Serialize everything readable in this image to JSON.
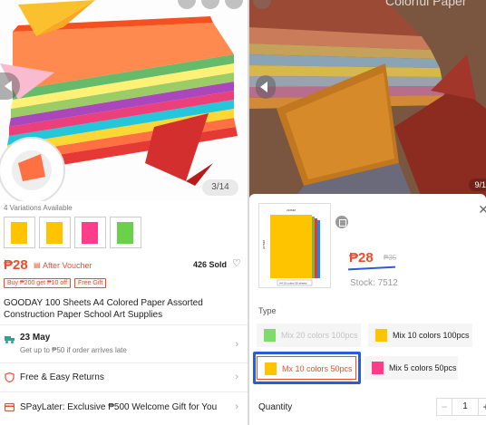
{
  "left": {
    "image_counter": "3/14",
    "variations_label": "4 Variations Available",
    "thumbnail_colors": [
      "#ffc400",
      "#ffc400",
      "#ff3d8b",
      "#6bd04a"
    ],
    "price": "₱28",
    "price_icon": "voucher-tag-icon",
    "after_voucher": "After Voucher",
    "sold": "426 Sold",
    "vouchers": [
      "Buy ₱200 get ₱10 off",
      "Free Gift"
    ],
    "title": "GOODAY 100 Sheets A4 Colored Paper Assorted Construction Paper School Art Supplies",
    "delivery": {
      "date": "23 May",
      "note": "Get up to ₱50 if order arrives late"
    },
    "returns": "Free & Easy Returns",
    "spaylater": "SPayLater: Exclusive ₱500 Welcome Gift for You"
  },
  "right": {
    "image_title": "Colorful Paper",
    "image_counter": "9/1",
    "sheet": {
      "price": "₱28",
      "original_price": "₱35",
      "stock": "Stock: 7512",
      "type_label": "Type",
      "options": [
        {
          "label": "Mix 20 colors 100pcs",
          "state": "disabled",
          "color": "#7ddc6a"
        },
        {
          "label": "Mix 10 colors 100pcs",
          "state": "normal",
          "color": "#ffc400"
        },
        {
          "label": "Mx 10 colors 50pcs",
          "state": "selected",
          "color": "#ffc400"
        },
        {
          "label": "Mix 5 colors 50pcs",
          "state": "normal",
          "color": "#ff3d8b"
        }
      ],
      "quantity_label": "Quantity",
      "quantity": "1",
      "minus": "−",
      "plus": "+"
    }
  },
  "colors": {
    "accent": "#ee4d2d",
    "highlight": "#2a5bdc"
  }
}
